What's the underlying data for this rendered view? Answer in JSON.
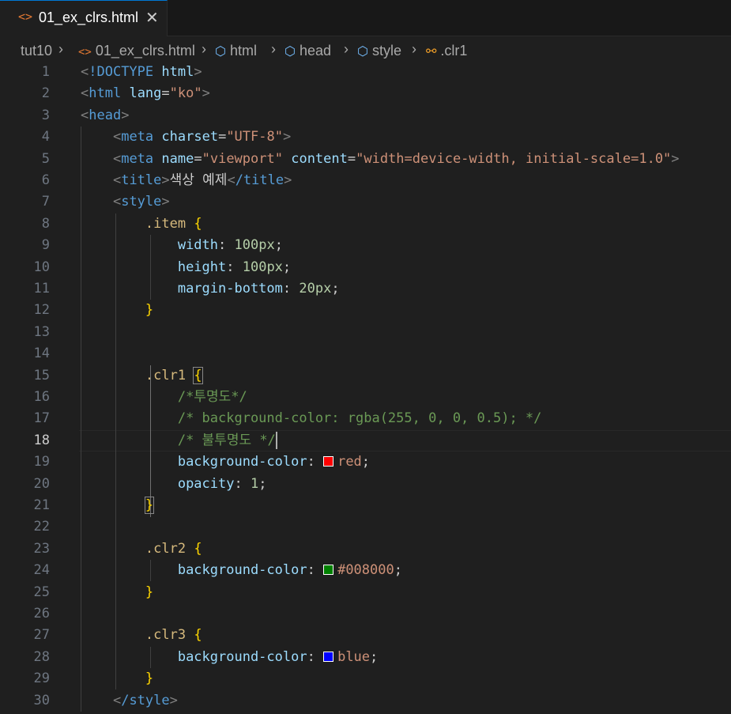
{
  "tabs": [
    {
      "label": "01_ex_clrs.html",
      "active": true
    }
  ],
  "breadcrumb": [
    "tut10",
    "01_ex_clrs.html",
    "html",
    "head",
    "style",
    ".clr1"
  ],
  "editor": {
    "active_line": 18,
    "line_numbers": [
      "1",
      "2",
      "3",
      "4",
      "5",
      "6",
      "7",
      "8",
      "9",
      "10",
      "11",
      "12",
      "13",
      "14",
      "15",
      "16",
      "17",
      "18",
      "19",
      "20",
      "21",
      "22",
      "23",
      "24",
      "25",
      "26",
      "27",
      "28",
      "29",
      "30"
    ],
    "lines": {
      "l1": {
        "doctype": "!DOCTYPE",
        "html": "html"
      },
      "l2": {
        "tag": "html",
        "attr": "lang",
        "value": "\"ko\""
      },
      "l3": {
        "tag": "head"
      },
      "l4": {
        "tag": "meta",
        "attr": "charset",
        "value": "\"UTF-8\""
      },
      "l5": {
        "tag": "meta",
        "attr1": "name",
        "value1": "\"viewport\"",
        "attr2": "content",
        "value2": "\"width=device-width, initial-scale=1.0\""
      },
      "l6": {
        "tag": "title",
        "text": "색상 예제",
        "close": "/title"
      },
      "l7": {
        "tag": "style"
      },
      "l8": {
        "selector": ".item"
      },
      "l9": {
        "prop": "width",
        "value": "100px"
      },
      "l10": {
        "prop": "height",
        "value": "100px"
      },
      "l11": {
        "prop": "margin-bottom",
        "value": "20px"
      },
      "l14": {
        "selector": ".clr1"
      },
      "l15": {
        "comment": "/*투명도*/"
      },
      "l16": {
        "comment": "/* background-color: rgba(255, 0, 0, 0.5); */"
      },
      "l18": {
        "comment": "/* 불투명도 */"
      },
      "l19": {
        "prop": "background-color",
        "value": "red",
        "swatch": "#ff0000"
      },
      "l20": {
        "prop": "opacity",
        "value": "1"
      },
      "l23": {
        "selector": ".clr2"
      },
      "l24": {
        "prop": "background-color",
        "value": "#008000",
        "swatch": "#008000"
      },
      "l27": {
        "selector": ".clr3"
      },
      "l28": {
        "prop": "background-color",
        "value": "blue",
        "swatch": "#0000ff"
      },
      "l30": {
        "close": "/style"
      }
    }
  },
  "colors": {
    "background": "#1f1f1f",
    "tag": "#569cd6",
    "attribute": "#9cdcfe",
    "string": "#ce9178",
    "selector": "#d7ba7d",
    "brace": "#ffd700",
    "number": "#b5cea8",
    "comment": "#6a9955"
  },
  "icons": {
    "tab_file": "html-file-icon",
    "tab_close": "close-icon",
    "breadcrumb_separator": "chevron-right-icon",
    "breadcrumb_element": "cube-icon",
    "breadcrumb_selector": "css-selector-icon"
  }
}
